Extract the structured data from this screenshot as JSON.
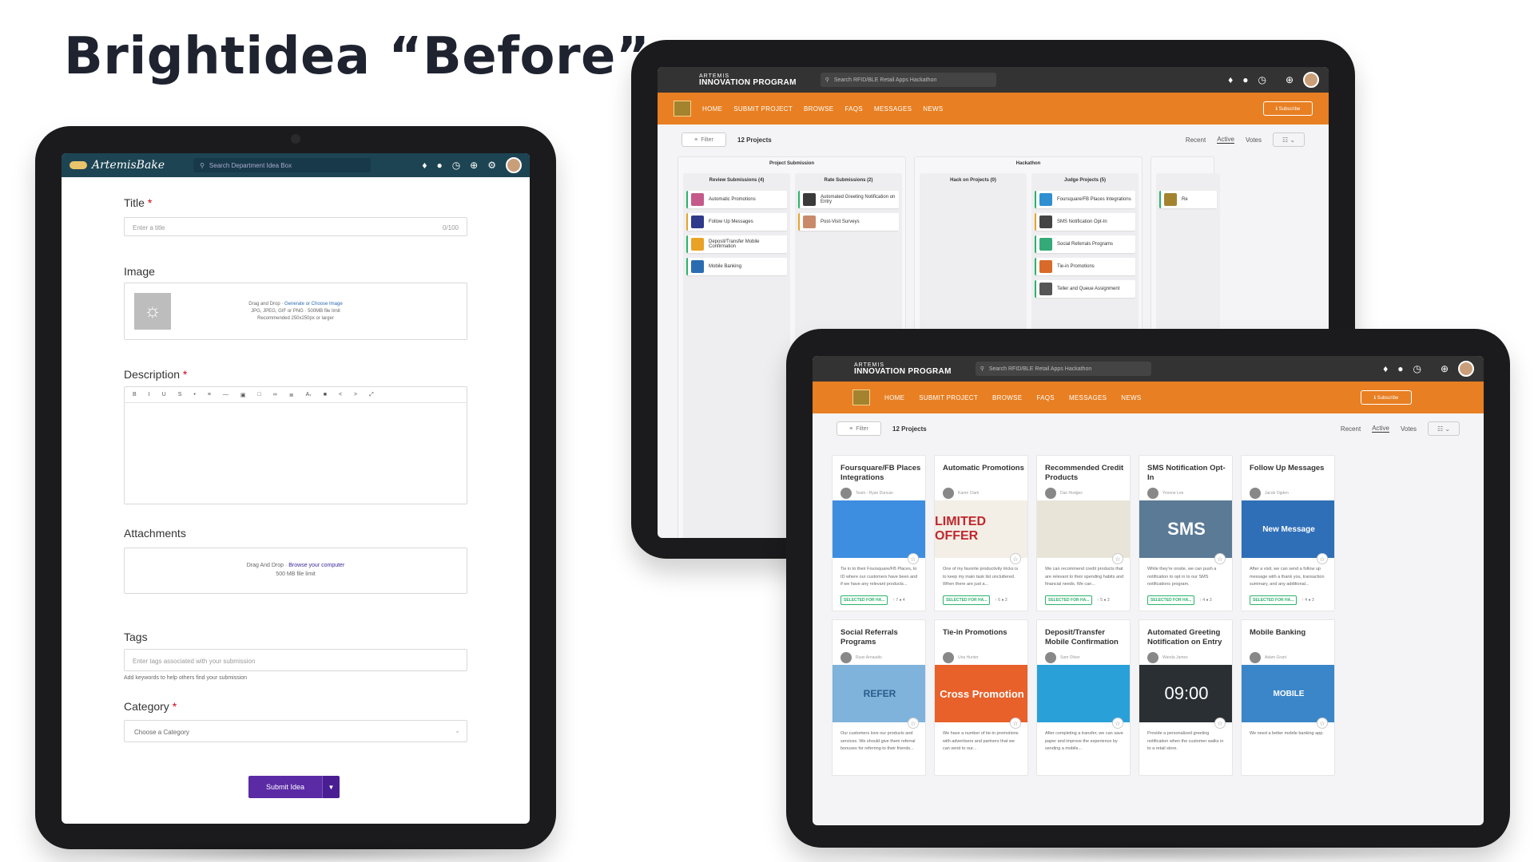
{
  "headline": "Brightidea “Before”",
  "form_app": {
    "logo": "ArtemisBake",
    "search_placeholder": "Search Department Idea Box",
    "title_label": "Title",
    "title_placeholder": "Enter a title",
    "title_counter": "0/100",
    "image_label": "Image",
    "image_drop_prefix": "Drag and Drop · ",
    "image_drop_link": "Generate or Choose Image",
    "image_types": "JPG, JPEG, GIF or PNG · 500MB file limit",
    "image_recommended": "Recommended 250x250px or larger",
    "description_label": "Description",
    "toolbar": [
      "B",
      "I",
      "U",
      "S",
      "•",
      "≡",
      "—",
      "▣",
      "□",
      "∞",
      "≣",
      "A₇",
      "■",
      "<",
      ">",
      "⤢"
    ],
    "attachments_label": "Attachments",
    "attach_drop_prefix": "Drag And Drop · ",
    "attach_drop_link": "Browse your computer",
    "attach_limit": "500 MB file limit",
    "tags_label": "Tags",
    "tags_placeholder": "Enter tags associated with your submission",
    "tags_hint": "Add keywords to help others find your submission",
    "category_label": "Category",
    "category_placeholder": "Choose a Category",
    "submit_label": "Submit Idea"
  },
  "program": {
    "logo_small": "ARTEMIS",
    "logo_big": "INNOVATION PROGRAM",
    "search_placeholder": "Search RFID/BLE Retail Apps Hackathon",
    "nav": [
      "HOME",
      "SUBMIT PROJECT",
      "BROWSE",
      "FAQS",
      "MESSAGES",
      "NEWS"
    ],
    "subscribe": "ℹ Subscribe",
    "filter": "Filter",
    "count": "12 Projects",
    "sort": [
      "Recent",
      "Active",
      "Votes"
    ]
  },
  "kanban": {
    "groups": [
      {
        "title": "Project Submission",
        "columns": [
          {
            "title": "Review Submissions (4)",
            "cards": [
              "Automatic Promotions",
              "Follow Up Messages",
              "Deposit/Transfer Mobile Confirmation",
              "Mobile Banking"
            ]
          },
          {
            "title": "Rate Submissions (2)",
            "cards": [
              "Automated Greeting Notification on Entry",
              "Post-Visit Surveys"
            ]
          }
        ]
      },
      {
        "title": "Hackathon",
        "columns": [
          {
            "title": "Hack on Projects (0)",
            "cards": []
          },
          {
            "title": "Judge Projects (5)",
            "cards": [
              "Foursquare/FB Places Integrations",
              "SMS Notification Opt-In",
              "Social Referrals Programs",
              "Tie-in Promotions",
              "Teller and Queue Assignment"
            ]
          }
        ]
      }
    ],
    "partial_card": "Re"
  },
  "grid": {
    "badge": "SELECTED FOR HA...",
    "cards": [
      {
        "title": "Foursquare/FB Places Integrations",
        "user": "Team - Ryan Duncan",
        "image_text": "",
        "image_color": "#3d8ee0",
        "desc": "Tie in to their Foursquare/FB Places, to ID where our customers have been and if we have any relevant products...",
        "stats": "↑ 7  ● 4"
      },
      {
        "title": "Automatic Promotions",
        "user": "Karen Clark",
        "image_text": "LIMITED OFFER",
        "image_color": "#c0272d",
        "desc": "One of my favorite productivity tricks is to keep my main task list uncluttered. When there are just a...",
        "stats": "↑ 6  ● 3"
      },
      {
        "title": "Recommended Credit Products",
        "user": "Dan Hodges",
        "image_text": "",
        "image_color": "#e8e4d8",
        "desc": "We can recommend credit products that are relevant to their spending habits and financial needs. We can...",
        "stats": "↑ 5  ● 3"
      },
      {
        "title": "SMS Notification Opt-In",
        "user": "Yvonne Lee",
        "image_text": "SMS",
        "image_color": "#5a7a96",
        "desc": "While they're onsite, we can push a notification to opt in to our SMS notifications program.",
        "stats": "↑ 4  ● 3"
      },
      {
        "title": "Follow Up Messages",
        "user": "Jacob Ogden",
        "image_text": "New Message",
        "image_color": "#2f6fb8",
        "desc": "After a visit, we can send a follow up message with a thank you, transaction summary, and any additional...",
        "stats": "↑ 4  ● 3"
      },
      {
        "title": "Social Referrals Programs",
        "user": "Ryan Arnaudio",
        "image_text": "REFER",
        "image_color": "#7fb3dc",
        "desc": "Our customers love our products and services. We should give them referral bonuses for referring to their friends...",
        "stats": ""
      },
      {
        "title": "Tie-in Promotions",
        "user": "Una Hunter",
        "image_text": "Cross Promotion",
        "image_color": "#e8602a",
        "desc": "We have a number of tie-in promotions with advertisers and partners that we can send to our...",
        "stats": ""
      },
      {
        "title": "Deposit/Transfer Mobile Confirmation",
        "user": "Sam Oliver",
        "image_text": "",
        "image_color": "#2aa0d8",
        "desc": "After completing a transfer, we can save paper and improve the experience by sending a mobile...",
        "stats": ""
      },
      {
        "title": "Automated Greeting Notification on Entry",
        "user": "Wanda James",
        "image_text": "09:00",
        "image_color": "#2a2f33",
        "desc": "Provide a personalized greeting notification when the customer walks in to a retail store.",
        "stats": ""
      },
      {
        "title": "Mobile Banking",
        "user": "Adam Grant",
        "image_text": "MOBILE",
        "image_color": "#3b86c8",
        "desc": "We need a better mobile banking app.",
        "stats": ""
      }
    ]
  }
}
